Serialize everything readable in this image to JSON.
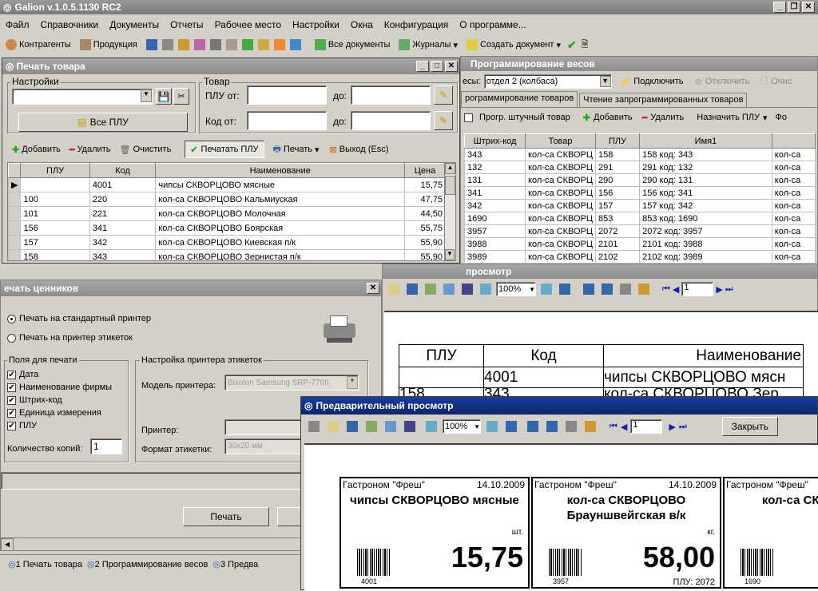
{
  "app": {
    "title": "Galion  v.1.0.5.1130 RC2"
  },
  "menu": [
    "Файл",
    "Справочники",
    "Документы",
    "Отчеты",
    "Рабочее место",
    "Настройки",
    "Окна",
    "Конфигурация",
    "О программе..."
  ],
  "toolbar": {
    "contractors": "Контрагенты",
    "products": "Продукция",
    "all_docs": "Все документы",
    "journals": "Журналы",
    "create_doc": "Создать документ"
  },
  "print_goods": {
    "title": "Печать товара",
    "settings_label": "Настройки",
    "all_plu": "Все ПЛУ",
    "goods_label": "Товар",
    "plu_from": "ПЛУ от:",
    "to1": "до:",
    "code_from": "Код от:",
    "to2": "до:",
    "add": "Добавить",
    "delete": "Удалить",
    "clear": "Очистить",
    "print_plu": "Печатать ПЛУ",
    "print": "Печать",
    "exit": "Выход (Esc)",
    "columns": [
      "ПЛУ",
      "Код",
      "Наименование",
      "Цена"
    ],
    "rows": [
      {
        "plu": "",
        "code": "4001",
        "name": "чипсы СКВОРЦОВО мясные",
        "price": "15,75"
      },
      {
        "plu": "100",
        "code": "220",
        "name": "кол-са СКВОРЦОВО Кальмиуская",
        "price": "47,75"
      },
      {
        "plu": "101",
        "code": "221",
        "name": "кол-са СКВОРЦОВО Молочная",
        "price": "44,50"
      },
      {
        "plu": "156",
        "code": "341",
        "name": "кол-са СКВОРЦОВО Боярская",
        "price": "55,75"
      },
      {
        "plu": "157",
        "code": "342",
        "name": "кол-са СКВОРЦОВО Киевская п/к",
        "price": "55,90"
      },
      {
        "plu": "158",
        "code": "343",
        "name": "кол-са СКВОРЦОВО Зернистая п/к",
        "price": "55,90"
      }
    ]
  },
  "price_tags": {
    "title": "ечать ценников",
    "std_printer": "Печать на стандартный принтер",
    "label_printer": "Печать на принтер этикеток",
    "fields_label": "Поля для печати",
    "fields": [
      "Дата",
      "Наименование фирмы",
      "Штрих-код",
      "Единица измерения",
      "ПЛУ"
    ],
    "copies_label": "Количество копий:",
    "copies": "1",
    "printer_settings": "Настройка принтера этикеток",
    "model_label": "Модель принтера:",
    "model": "Bixolon Samsung SRP-770II",
    "printer_label": "Принтер:",
    "format_label": "Формат этикетки:",
    "format": "30x20 мм",
    "print_btn": "Печать"
  },
  "scales": {
    "title": "Программирование весов",
    "scales_label": "есы:",
    "scales_value": "отдел  2 (колбаса)",
    "connect": "Подключить",
    "disconnect": "Отключить",
    "clear": "Очис",
    "tab1": "рограммирование товаров",
    "tab2": "Чтение запрограммированных товаров",
    "piece": "Прогр.  штучный товар",
    "add": "Добавить",
    "delete": "Удалить",
    "assign": "Назначить ПЛУ",
    "fo": "Фо",
    "columns": [
      "Штрих-код",
      "Товар",
      "ПЛУ",
      "Имя1",
      ""
    ],
    "rows": [
      {
        "bar": "343",
        "goods": "кол-са СКВОРЦ",
        "plu": "158",
        "name": "158   код: 343",
        "x": "кол-са"
      },
      {
        "bar": "132",
        "goods": "кол-са СКВОРЦ",
        "plu": "291",
        "name": "291   код: 132",
        "x": "кол-са"
      },
      {
        "bar": "131",
        "goods": "кол-са СКВОРЦ",
        "plu": "290",
        "name": "290   код: 131",
        "x": "кол-са"
      },
      {
        "bar": "341",
        "goods": "кол-са СКВОРЦ",
        "plu": "156",
        "name": "156   код: 341",
        "x": "кол-са"
      },
      {
        "bar": "342",
        "goods": "кол-са СКВОРЦ",
        "plu": "157",
        "name": "157   код: 342",
        "x": "кол-са"
      },
      {
        "bar": "1690",
        "goods": "кол-са СКВОРЦ",
        "plu": "853",
        "name": "853   код: 1690",
        "x": "кол-са"
      },
      {
        "bar": "3957",
        "goods": "кол-са СКВОРЦ",
        "plu": "2072",
        "name": "2072    код: 3957",
        "x": "кол-са"
      },
      {
        "bar": "3988",
        "goods": "кол-са СКВОРЦ",
        "plu": "2101",
        "name": "2101    код: 3988",
        "x": "кол-са"
      },
      {
        "bar": "3989",
        "goods": "кол-са СКВОРЦ",
        "plu": "2102",
        "name": "2102    код: 3989",
        "x": "кол-са"
      }
    ]
  },
  "preview_back": {
    "title": "просмотр",
    "zoom": "100%",
    "page": "1",
    "columns": [
      "ПЛУ",
      "Код",
      "Наименование"
    ],
    "row1": {
      "plu": "",
      "code": "4001",
      "name": "чипсы СКВОРЦОВО мясн"
    },
    "row2": {
      "plu": "158",
      "code": "343",
      "name": "кол-са СКВОРЦОВО Зер"
    }
  },
  "preview": {
    "title": "Предварительный просмотр",
    "zoom": "100%",
    "page": "1",
    "close": "Закрыть",
    "labels": [
      {
        "shop": "Гастроном \"Фреш\"",
        "date": "14.10.2009",
        "name": "чипсы СКВОРЦОВО мясные",
        "unit": "шт.",
        "price": "15,75",
        "code": "4001",
        "plu": ""
      },
      {
        "shop": "Гастроном \"Фреш\"",
        "date": "14.10.2009",
        "name": "кол-са СКВОРЦОВО Брауншвейгская в/к",
        "unit": "кг.",
        "price": "58,00",
        "code": "3957",
        "plu": "ПЛУ: 2072"
      },
      {
        "shop": "Гастроном \"Фреш\"",
        "date": "",
        "name": "кол-са СКВ Дрогоб",
        "unit": "",
        "price": "",
        "code": "1690",
        "plu": ""
      }
    ]
  },
  "taskbar": [
    "1 Печать товара",
    "2 Программирование весов",
    "3 Предва"
  ]
}
